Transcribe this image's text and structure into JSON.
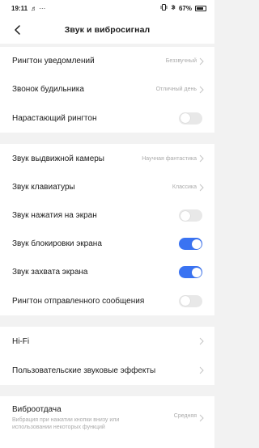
{
  "status_bar": {
    "time": "19:11",
    "extra": "♬ ···",
    "battery": "67%"
  },
  "header": {
    "title": "Звук и вибросигнал"
  },
  "colors": {
    "accent": "#3a73f2",
    "toggle_off": "#e8e8e8",
    "secondary_text": "#aaaaaa"
  },
  "rows": {
    "notif_ringtone": {
      "label": "Рингтон уведомлений",
      "value": "Беззвучный"
    },
    "alarm": {
      "label": "Звонок будильника",
      "value": "Отличный день"
    },
    "rising": {
      "label": "Нарастающий рингтон",
      "checked": false
    },
    "popup_camera": {
      "label": "Звук выдвижной камеры",
      "value": "Научная фантастика"
    },
    "keyboard": {
      "label": "Звук клавиатуры",
      "value": "Классика"
    },
    "tap": {
      "label": "Звук нажатия на экран",
      "checked": false
    },
    "lock": {
      "label": "Звук блокировки экрана",
      "checked": true
    },
    "screenshot": {
      "label": "Звук захвата экрана",
      "checked": true
    },
    "sent_msg": {
      "label": "Рингтон отправленного сообщения",
      "checked": false
    },
    "hifi": {
      "label": "Hi-Fi"
    },
    "custom_effects": {
      "label": "Пользовательские звуковые эффекты"
    },
    "vibration": {
      "label": "Виброотдача",
      "value": "Средняя",
      "subtext_1": "Вибрация при нажатии кнопки внизу или",
      "subtext_2": "использовании некоторых функций"
    }
  }
}
